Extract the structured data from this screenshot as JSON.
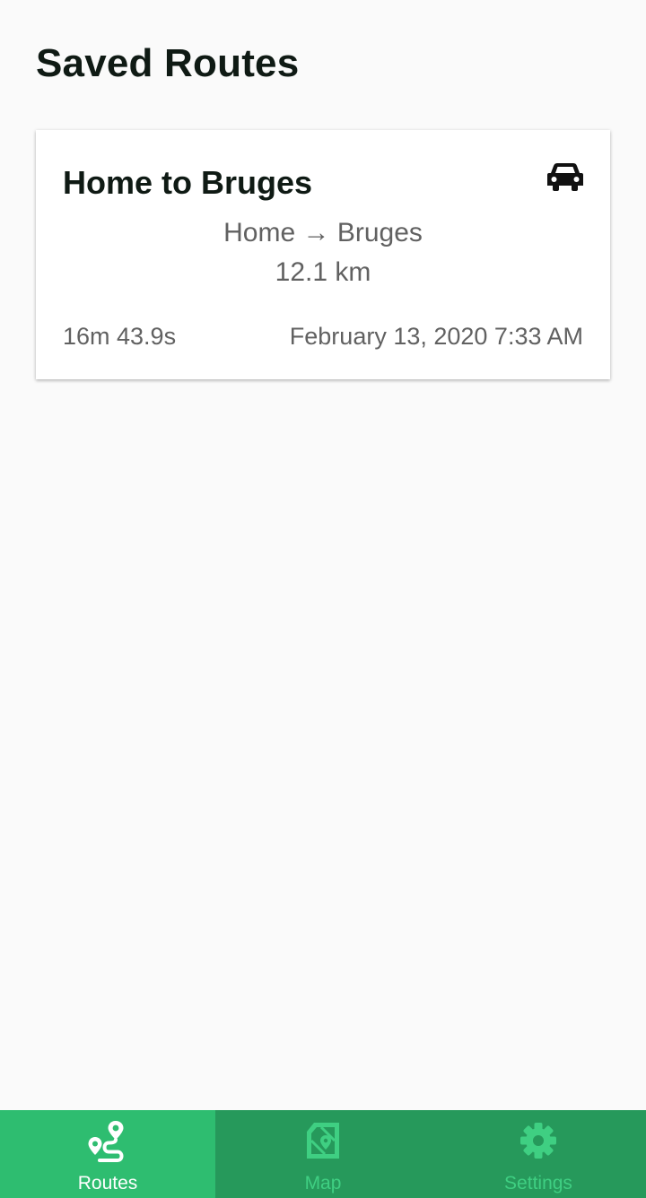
{
  "header": {
    "title": "Saved Routes"
  },
  "routes": [
    {
      "name": "Home to Bruges",
      "path": "Home → Bruges",
      "distance": "12.1 km",
      "duration": "16m 43.9s",
      "date": "February 13, 2020 7:33 AM",
      "transport_icon": "car-icon"
    }
  ],
  "bottom_nav": {
    "items": [
      {
        "label": "Routes",
        "icon": "route-icon",
        "active": true
      },
      {
        "label": "Map",
        "icon": "map-icon",
        "active": false
      },
      {
        "label": "Settings",
        "icon": "gear-icon",
        "active": false
      }
    ]
  },
  "colors": {
    "background": "#fafafa",
    "nav_bar": "#26995b",
    "nav_active": "#2ebd70",
    "nav_inactive_text": "#3fcf82",
    "title_text": "#0f1a14",
    "secondary_text": "#616161"
  }
}
